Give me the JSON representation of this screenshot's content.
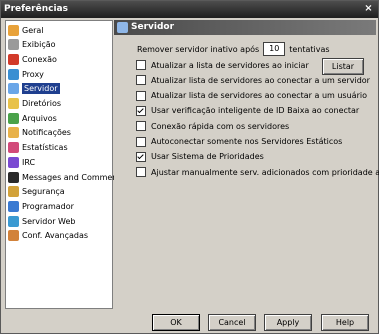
{
  "window": {
    "title": "Preferências",
    "close_glyph": "×"
  },
  "sidebar": {
    "selected_index": 4,
    "items": [
      {
        "label": "Geral",
        "icon": "settings-icon",
        "color": "#e8a23a"
      },
      {
        "label": "Exibição",
        "icon": "display-icon",
        "color": "#9a9a9a"
      },
      {
        "label": "Conexão",
        "icon": "connection-icon",
        "color": "#d23a2a"
      },
      {
        "label": "Proxy",
        "icon": "proxy-icon",
        "color": "#3a8fd2"
      },
      {
        "label": "Servidor",
        "icon": "server-icon",
        "color": "#6aa6e8"
      },
      {
        "label": "Diretórios",
        "icon": "folder-icon",
        "color": "#e8c24a"
      },
      {
        "label": "Arquivos",
        "icon": "files-icon",
        "color": "#4aa24a"
      },
      {
        "label": "Notificações",
        "icon": "notifications-icon",
        "color": "#e8b24a"
      },
      {
        "label": "Estatísticas",
        "icon": "statistics-icon",
        "color": "#d24a7a"
      },
      {
        "label": "IRC",
        "icon": "irc-icon",
        "color": "#7a4ad2"
      },
      {
        "label": "Messages and Comments",
        "icon": "messages-icon",
        "color": "#2a2a2a"
      },
      {
        "label": "Segurança",
        "icon": "security-icon",
        "color": "#d2a23a"
      },
      {
        "label": "Programador",
        "icon": "scheduler-icon",
        "color": "#3a7ad2"
      },
      {
        "label": "Servidor Web",
        "icon": "web-server-icon",
        "color": "#3a9ad2"
      },
      {
        "label": "Conf. Avançadas",
        "icon": "advanced-settings-icon",
        "color": "#d2823a"
      }
    ]
  },
  "panel": {
    "title": "Servidor",
    "icon": "server-icon",
    "remove_inactive": {
      "before": "Remover servidor inativo após",
      "value": "10",
      "after": "tentativas"
    },
    "list_button": "Listar",
    "options": [
      {
        "label": "Atualizar a lista de servidores ao iniciar",
        "checked": false
      },
      {
        "label": "Atualizar lista de servidores ao conectar a um servidor",
        "checked": false
      },
      {
        "label": "Atualizar lista de servidores ao conectar a um usuário",
        "checked": false
      },
      {
        "label": "Usar verificação inteligente de ID Baixa ao conectar",
        "checked": true
      },
      {
        "label": "Conexão rápida com os servidores",
        "checked": false
      },
      {
        "label": "Autoconectar somente nos Servidores Estáticos",
        "checked": false
      },
      {
        "label": "Usar Sistema de Prioridades",
        "checked": true
      },
      {
        "label": "Ajustar manualmente serv. adicionados com prioridade alta",
        "checked": false
      }
    ]
  },
  "buttons": {
    "ok": "OK",
    "cancel": "Cancel",
    "apply": "Apply",
    "help": "Help"
  }
}
